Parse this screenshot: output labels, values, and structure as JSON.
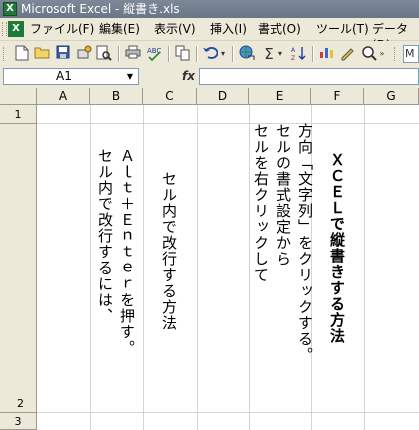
{
  "window": {
    "title": "Microsoft Excel - 縦書き.xls",
    "app_icon": "excel-icon"
  },
  "menubar": {
    "items": [
      "ファイル(F)",
      "編集(E)",
      "表示(V)",
      "挿入(I)",
      "書式(O)",
      "ツール(T)",
      "データ(D)"
    ]
  },
  "toolbar": {
    "buttons": [
      "new-icon",
      "open-icon",
      "save-icon",
      "permission-icon",
      "print-preview-icon",
      "print-icon",
      "spelling-icon",
      "copy-icon",
      "undo-icon",
      "hyperlink-icon",
      "autosum-icon",
      "sort-icon",
      "chart-icon",
      "font-size-icon",
      "more-icon"
    ],
    "font_box": "M"
  },
  "formula_bar": {
    "name_box": "A1",
    "fx_label": "fx",
    "content": ""
  },
  "sheet": {
    "columns": [
      "A",
      "B",
      "C",
      "D",
      "E",
      "F",
      "G"
    ],
    "rows": [
      "1",
      "2",
      "3"
    ],
    "cells": {
      "B2": "Ａｌｔ＋Ｅｎｔｅｒを押す。\nセル内で改行するには、",
      "C2": "セル内で改行する方法",
      "E2": "方向「文字列」をクリックする。\nセルの書式設定から\nセルを右クリックして",
      "F2": "ＸＣＥＬで縦書きする方法"
    }
  }
}
